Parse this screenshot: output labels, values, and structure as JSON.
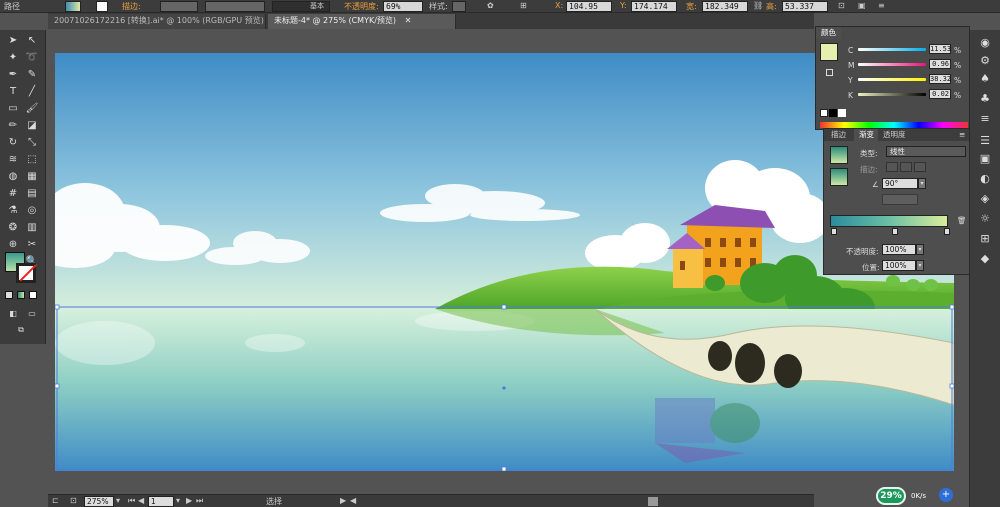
{
  "control_bar": {
    "path_label": "路径",
    "stroke_label": "描边:",
    "stroke_style": "基本",
    "opacity_label": "不透明度:",
    "opacity_value": "69%",
    "style_label": "样式:",
    "x_label": "X:",
    "x_value": "104.95 mm",
    "y_label": "Y:",
    "y_value": "174.174",
    "w_label": "宽:",
    "w_value": "182.349",
    "h_label": "高:",
    "h_value": "53.337 mm"
  },
  "tabs": [
    {
      "label": "20071026172216 [转换].ai* @ 100% (RGB/GPU 预览)"
    },
    {
      "label": "未标题-4* @ 275% (CMYK/预览)"
    }
  ],
  "color_panel": {
    "tab": "颜色",
    "channels": [
      {
        "name": "C",
        "value": "11.53",
        "unit": "%"
      },
      {
        "name": "M",
        "value": "0.96",
        "unit": "%"
      },
      {
        "name": "Y",
        "value": "38.32",
        "unit": "%"
      },
      {
        "name": "K",
        "value": "0.02",
        "unit": "%"
      }
    ],
    "swatch_color": "#e6efb0"
  },
  "gradient_panel": {
    "tabs": [
      "描边",
      "渐变",
      "透明度"
    ],
    "type_label": "类型:",
    "type_value": "线性",
    "stroke_label": "描边:",
    "angle_value": "90°",
    "opacity_label": "不透明度:",
    "opacity_value": "100%",
    "position_label": "位置:",
    "position_value": "100%"
  },
  "status_bar": {
    "zoom": "275%",
    "page": "1",
    "tool": "选择"
  },
  "network_widget": {
    "percent": "29%",
    "speed": "0K/s"
  },
  "colors": {
    "ui_dark": "#3c3c3c",
    "ui_panel": "#4a4a4a",
    "sky_top": "#3f8cc6",
    "sky_bottom": "#c5e8d6",
    "water": "#8ecfc2",
    "grass": "#6fbf3a",
    "house": "#f3a21d",
    "roof": "#8e4fb3"
  }
}
